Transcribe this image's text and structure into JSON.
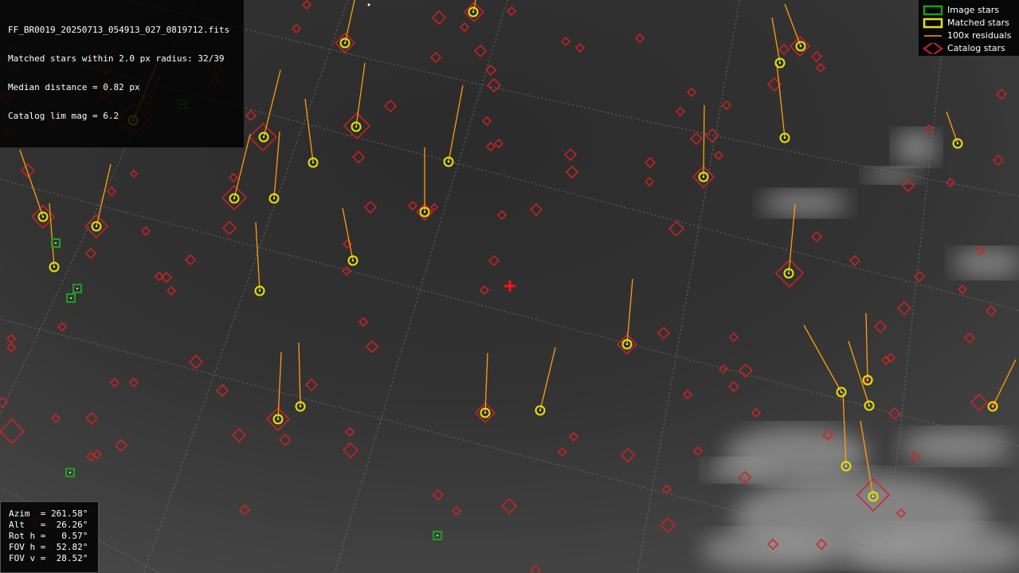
{
  "info": {
    "filename": "FF_BR0019_20250713_054913_027_0819712.fits",
    "matched": "Matched stars within 2.0 px radius: 32/39",
    "median": "Median distance = 0.82 px",
    "limmag": "Catalog lim mag = 6.2"
  },
  "legend": {
    "image_stars": "Image stars",
    "matched_stars": "Matched stars",
    "residuals": "100x residuals",
    "catalog_stars": "Catalog stars"
  },
  "pointing": {
    "azim": "Azim  = 261.58°",
    "alt": "Alt   =  26.26°",
    "rot": "Rot h =   0.57°",
    "fov_h": "FOV h =  52.82°",
    "fov_v": "FOV v =  28.52°"
  },
  "colors": {
    "catalog": "#d22222",
    "matched": "#e6e600",
    "image": "#1aa01a",
    "residual": "#ff9d0a",
    "center": "#ff1010"
  },
  "icons": {
    "center_marker": "red-cross-icon"
  }
}
